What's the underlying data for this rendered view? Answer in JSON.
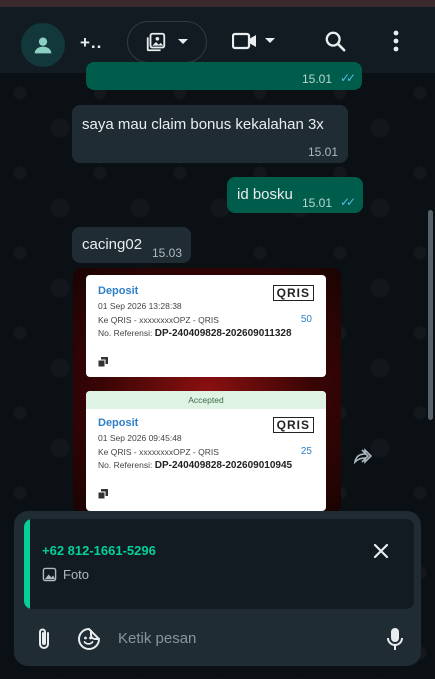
{
  "header": {
    "title": "+..",
    "icons": [
      "avatar-person-icon",
      "media-icon",
      "video-call-icon",
      "search-icon",
      "more-vert-icon"
    ]
  },
  "messages": [
    {
      "direction": "out",
      "text": "",
      "time": "15.01",
      "read": true
    },
    {
      "direction": "in",
      "text": "saya mau claim bonus kekalahan 3x",
      "time": "15.01"
    },
    {
      "direction": "out",
      "text": "id bosku",
      "time": "15.01",
      "read": true
    },
    {
      "direction": "in",
      "text": "cacing02",
      "time": "15.03"
    }
  ],
  "image_message": {
    "cards": [
      {
        "header": "",
        "title": "Deposit",
        "logo": "QRIS",
        "datetime": "01 Sep 2026 13:28:38",
        "dest": "Ke QRIS - xxxxxxxxOPZ - QRIS",
        "amount": "50",
        "ref_label": "No. Referensi:",
        "ref": "DP-240409828-202609011328"
      },
      {
        "header": "Accepted",
        "title": "Deposit",
        "logo": "QRIS",
        "datetime": "01 Sep 2026 09:45:48",
        "dest": "Ke QRIS - xxxxxxxxOPZ - QRIS",
        "amount": "25",
        "ref_label": "No. Referensi:",
        "ref": "DP-240409828-202609010945"
      }
    ]
  },
  "reply_preview": {
    "sender": "+62 812-1661-5296",
    "type_label": "Foto"
  },
  "composer": {
    "placeholder": "Ketik pesan"
  },
  "colors": {
    "accent": "#06cf9c",
    "outgoing_bubble": "#005c4b",
    "incoming_bubble": "#202c33",
    "read_ticks": "#53bdeb",
    "background": "#0b1014"
  }
}
